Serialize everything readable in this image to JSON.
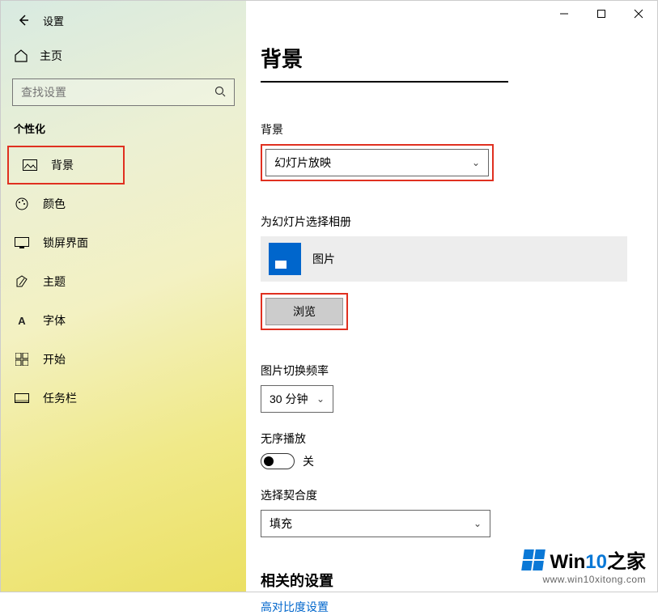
{
  "app": {
    "title": "设置"
  },
  "sidebar": {
    "home": "主页",
    "search_placeholder": "查找设置",
    "section": "个性化",
    "items": [
      {
        "label": "背景"
      },
      {
        "label": "颜色"
      },
      {
        "label": "锁屏界面"
      },
      {
        "label": "主题"
      },
      {
        "label": "字体"
      },
      {
        "label": "开始"
      },
      {
        "label": "任务栏"
      }
    ]
  },
  "main": {
    "title": "背景",
    "bg_label": "背景",
    "bg_value": "幻灯片放映",
    "album_label": "为幻灯片选择相册",
    "album_value": "图片",
    "browse": "浏览",
    "freq_label": "图片切换频率",
    "freq_value": "30 分钟",
    "shuffle_label": "无序播放",
    "shuffle_state": "关",
    "fit_label": "选择契合度",
    "fit_value": "填充",
    "related_title": "相关的设置",
    "related_link": "高对比度设置"
  },
  "watermark": {
    "brand_prefix": "Win",
    "brand_num": "10",
    "brand_suffix": "之家",
    "url": "www.win10xitong.com"
  }
}
